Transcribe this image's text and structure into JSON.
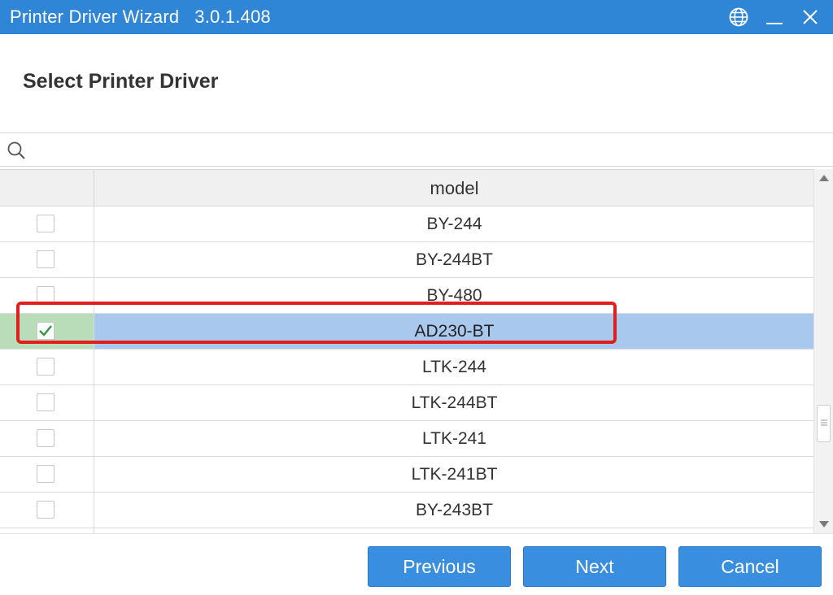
{
  "window": {
    "title": "Printer Driver Wizard   3.0.1.408",
    "icons": [
      "globe-icon",
      "minimize-icon",
      "close-icon"
    ]
  },
  "page": {
    "heading": "Select Printer Driver"
  },
  "search": {
    "value": "",
    "placeholder": "",
    "icon": "search-icon"
  },
  "table": {
    "columns": [
      "",
      "model"
    ],
    "rows": [
      {
        "model": "BY-244",
        "checked": false
      },
      {
        "model": "BY-244BT",
        "checked": false
      },
      {
        "model": "BY-480",
        "checked": false
      },
      {
        "model": "AD230-BT",
        "checked": true
      },
      {
        "model": "LTK-244",
        "checked": false
      },
      {
        "model": "LTK-244BT",
        "checked": false
      },
      {
        "model": "LTK-241",
        "checked": false
      },
      {
        "model": "LTK-241BT",
        "checked": false
      },
      {
        "model": "BY-243BT",
        "checked": false
      }
    ]
  },
  "buttons": {
    "previous": "Previous",
    "next": "Next",
    "cancel": "Cancel"
  },
  "colors": {
    "titlebar": "#2f86d6",
    "selected_row": "#a9c8ee",
    "selected_check_cell": "#b9dcb9",
    "highlight_border": "#e01e1e",
    "button": "#3a8ee0"
  }
}
